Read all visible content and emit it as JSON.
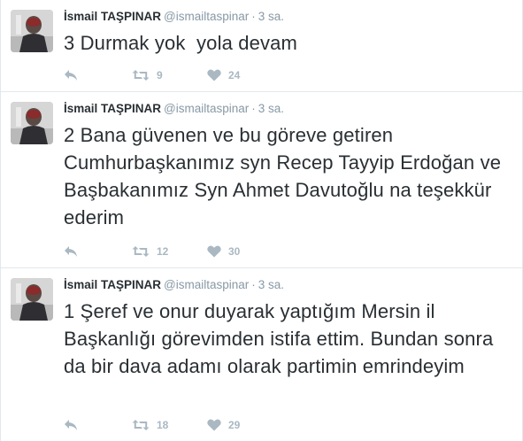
{
  "colors": {
    "text": "#292f33",
    "meta": "#8899a6",
    "action_icon": "#aab8c2",
    "divider": "#e1e8ed"
  },
  "tweets": [
    {
      "fullname": "İsmail TAŞPINAR",
      "username": "@ismailtaspinar",
      "separator": "·",
      "time": "3 sa.",
      "text": "3 Durmak yok  yola devam",
      "retweets": "9",
      "likes": "24",
      "icons": [
        "reply-icon",
        "retweet-icon",
        "heart-icon"
      ]
    },
    {
      "fullname": "İsmail TAŞPINAR",
      "username": "@ismailtaspinar",
      "separator": "·",
      "time": "3 sa.",
      "text": "2 Bana güvenen ve bu göreve getiren Cumhurbaşkanımız syn Recep Tayyip Erdoğan ve Başbakanımız Syn Ahmet Davutoğlu na teşekkür ederim",
      "retweets": "12",
      "likes": "30",
      "icons": [
        "reply-icon",
        "retweet-icon",
        "heart-icon"
      ]
    },
    {
      "fullname": "İsmail TAŞPINAR",
      "username": "@ismailtaspinar",
      "separator": "·",
      "time": "3 sa.",
      "text": "1 Şeref ve onur duyarak yaptığım Mersin il Başkanlığı görevimden istifa ettim. Bundan sonra da bir dava adamı olarak partimin emrindeyim",
      "retweets": "18",
      "likes": "29",
      "icons": [
        "reply-icon",
        "retweet-icon",
        "heart-icon"
      ]
    }
  ]
}
